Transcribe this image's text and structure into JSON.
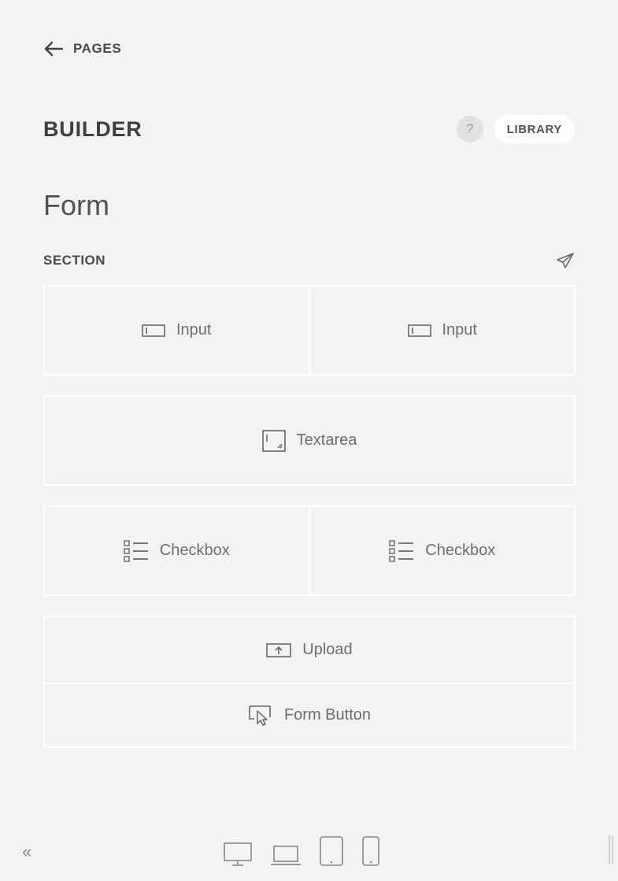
{
  "nav": {
    "back_label": "PAGES",
    "back_icon": "arrow-left-icon"
  },
  "header": {
    "title": "BUILDER",
    "help_label": "?",
    "library_label": "LIBRARY"
  },
  "form_title": "Form",
  "section": {
    "label": "SECTION",
    "action_icon": "send-icon"
  },
  "elements": {
    "row1": [
      {
        "label": "Input",
        "icon": "input-field-icon"
      },
      {
        "label": "Input",
        "icon": "input-field-icon"
      }
    ],
    "row2": [
      {
        "label": "Textarea",
        "icon": "textarea-icon"
      }
    ],
    "row3": [
      {
        "label": "Checkbox",
        "icon": "checkbox-list-icon"
      },
      {
        "label": "Checkbox",
        "icon": "checkbox-list-icon"
      }
    ],
    "row4": [
      {
        "label": "Upload",
        "icon": "upload-icon"
      },
      {
        "label": "Form Button",
        "icon": "cursor-click-icon"
      }
    ]
  },
  "footer": {
    "collapse_label": "«",
    "devices": [
      "desktop-icon",
      "laptop-icon",
      "tablet-icon",
      "mobile-icon"
    ]
  },
  "colors": {
    "background": "#f3f3f3",
    "divider": "#ffffff",
    "text": "#444444",
    "muted": "#6e6e6e"
  }
}
